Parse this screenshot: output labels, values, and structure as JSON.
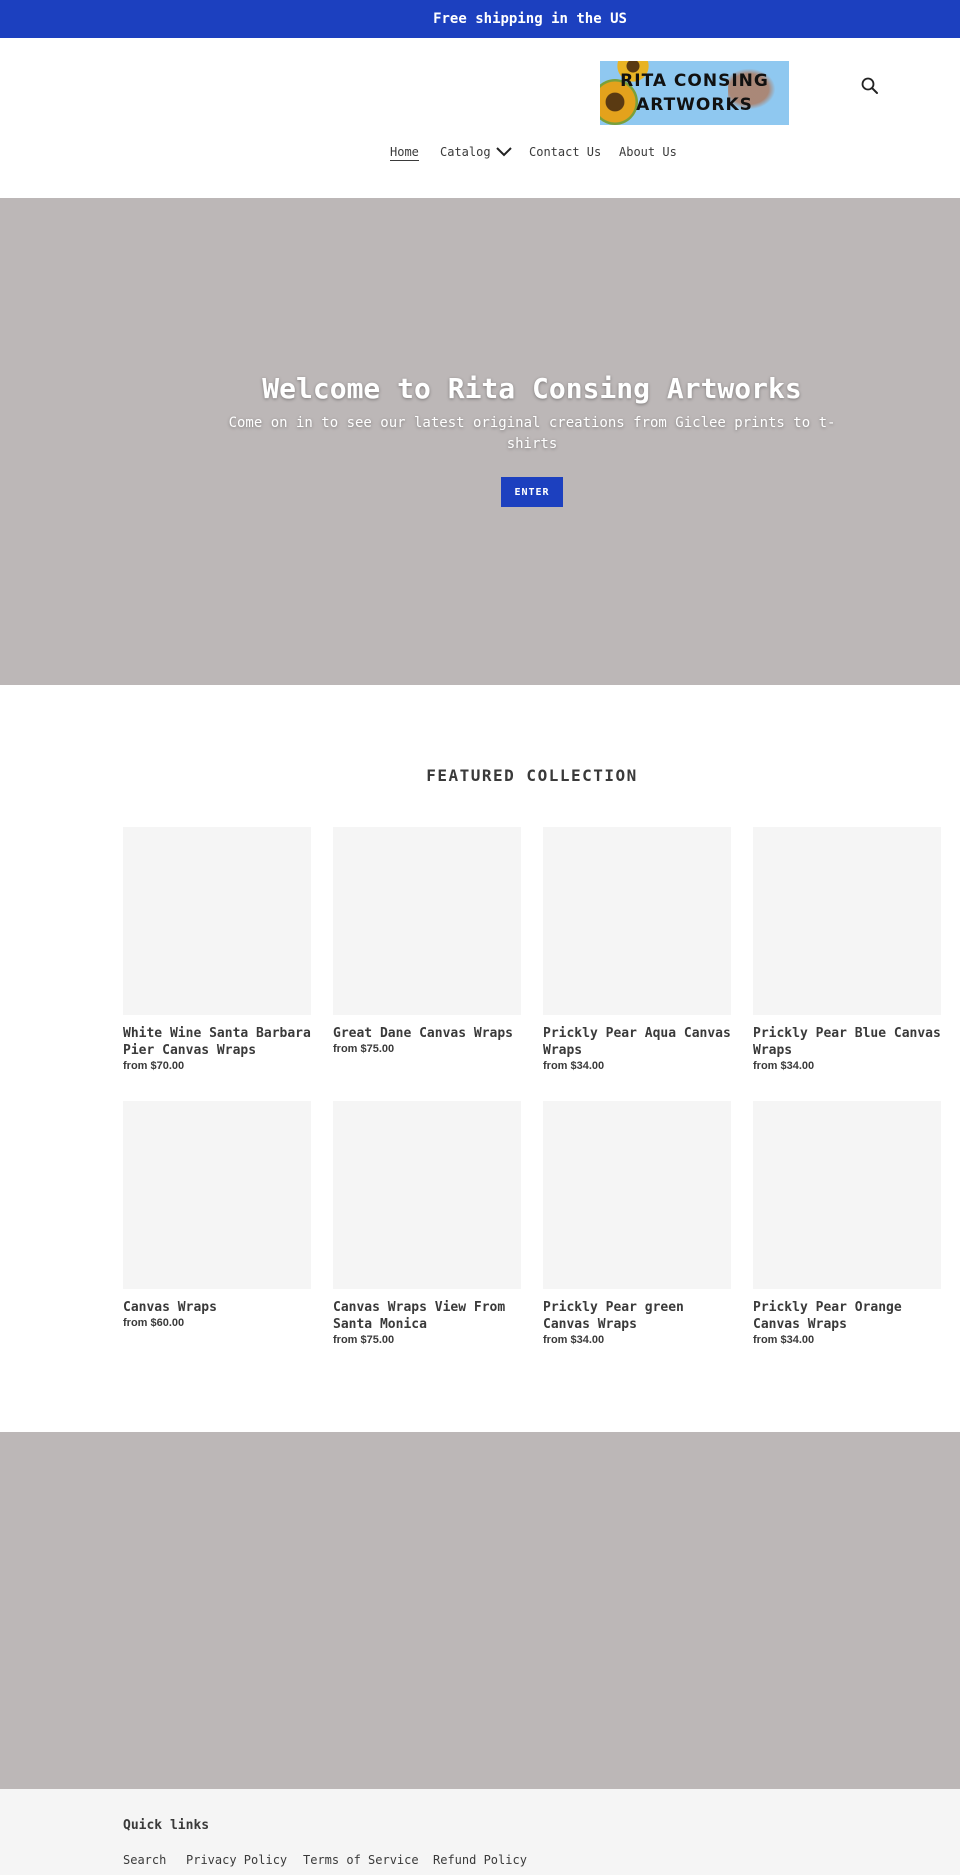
{
  "announcement": {
    "text": "Free shipping in the US"
  },
  "header": {
    "logo_lines": [
      "RITA CONSING",
      "ARTWORKS"
    ],
    "nav": [
      {
        "label": "Home",
        "active": true
      },
      {
        "label": "Catalog",
        "has_dropdown": true
      },
      {
        "label": "Contact Us"
      },
      {
        "label": "About Us"
      }
    ],
    "search_icon": "search-icon"
  },
  "hero": {
    "title": "Welcome to Rita Consing Artworks",
    "subtitle": "Come on in to see our latest original creations from Giclee prints to t-shirts",
    "button_label": "ENTER"
  },
  "featured": {
    "heading": "FEATURED COLLECTION",
    "products": [
      {
        "title": "White Wine Santa Barbara Pier Canvas Wraps",
        "price": "from $70.00"
      },
      {
        "title": "Great Dane Canvas Wraps",
        "price": "from $75.00"
      },
      {
        "title": "Prickly Pear Aqua Canvas Wraps",
        "price": "from $34.00"
      },
      {
        "title": "Prickly Pear Blue Canvas Wraps",
        "price": "from $34.00"
      },
      {
        "title": "Canvas Wraps",
        "price": "from $60.00"
      },
      {
        "title": "Canvas Wraps View From Santa Monica",
        "price": "from $75.00"
      },
      {
        "title": "Prickly Pear green Canvas Wraps",
        "price": "from $34.00"
      },
      {
        "title": "Prickly Pear Orange Canvas Wraps",
        "price": "from $34.00"
      }
    ]
  },
  "footer": {
    "heading": "Quick links",
    "links": [
      "Search",
      "Privacy Policy",
      "Terms of Service",
      "Refund Policy"
    ]
  },
  "colors": {
    "accent": "#1c40bf",
    "hero_bg": "#bcb7b7",
    "product_placeholder": "#f5f5f5",
    "footer_bg": "#f5f5f5",
    "text": "#3a3a3a"
  }
}
